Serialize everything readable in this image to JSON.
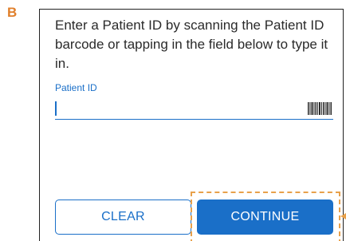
{
  "panel_letter": "B",
  "instructions": "Enter a Patient ID by scanning the Patient ID barcode or tapping in the field below to type it in.",
  "patient_field": {
    "label": "Patient ID",
    "value": ""
  },
  "buttons": {
    "clear_label": "CLEAR",
    "continue_label": "CONTINUE"
  },
  "colors": {
    "accent": "#1a6fc8",
    "panel_letter": "#e07f2b",
    "highlight": "#e8a14b"
  },
  "icons": {
    "barcode": "barcode-icon",
    "pointer": "pointer-arrow-icon"
  }
}
